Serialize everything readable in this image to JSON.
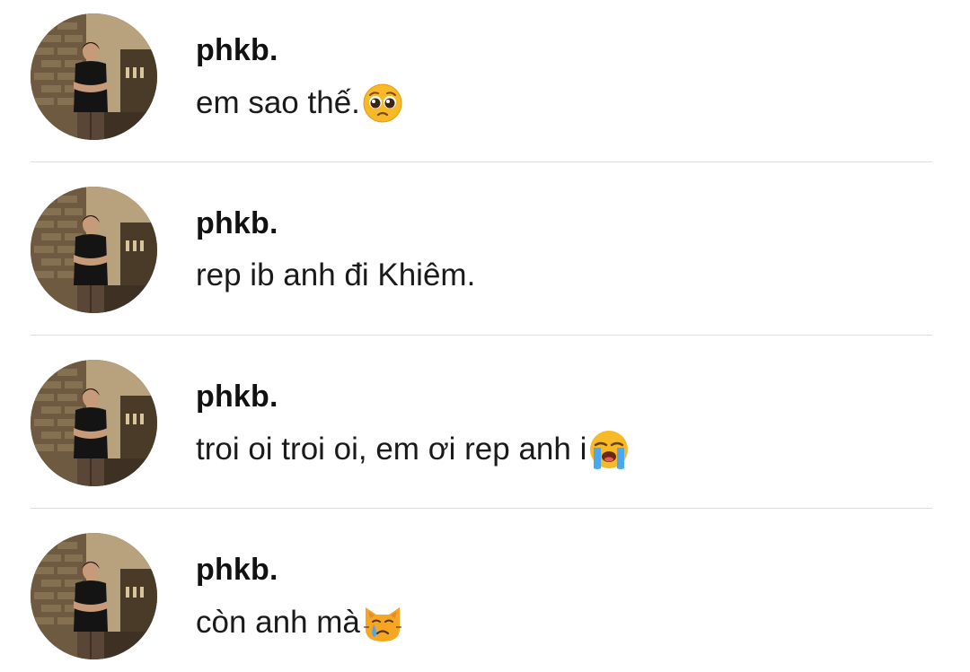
{
  "messages": [
    {
      "sender": "phkb.",
      "text": "em sao thế.",
      "emoji": "pleading-face-icon"
    },
    {
      "sender": "phkb.",
      "text": "rep ib anh đi Khiêm.",
      "emoji": ""
    },
    {
      "sender": "phkb.",
      "text": "troi oi troi oi, em ơi rep anh i",
      "emoji": "loudly-crying-face-icon"
    },
    {
      "sender": "phkb.",
      "text": "còn anh mà",
      "emoji": "crying-cat-face-icon"
    }
  ],
  "colors": {
    "background": "#ffffff",
    "divider": "#dedede",
    "text": "#1a1a1a",
    "emoji_yellow": "#f7b928"
  }
}
